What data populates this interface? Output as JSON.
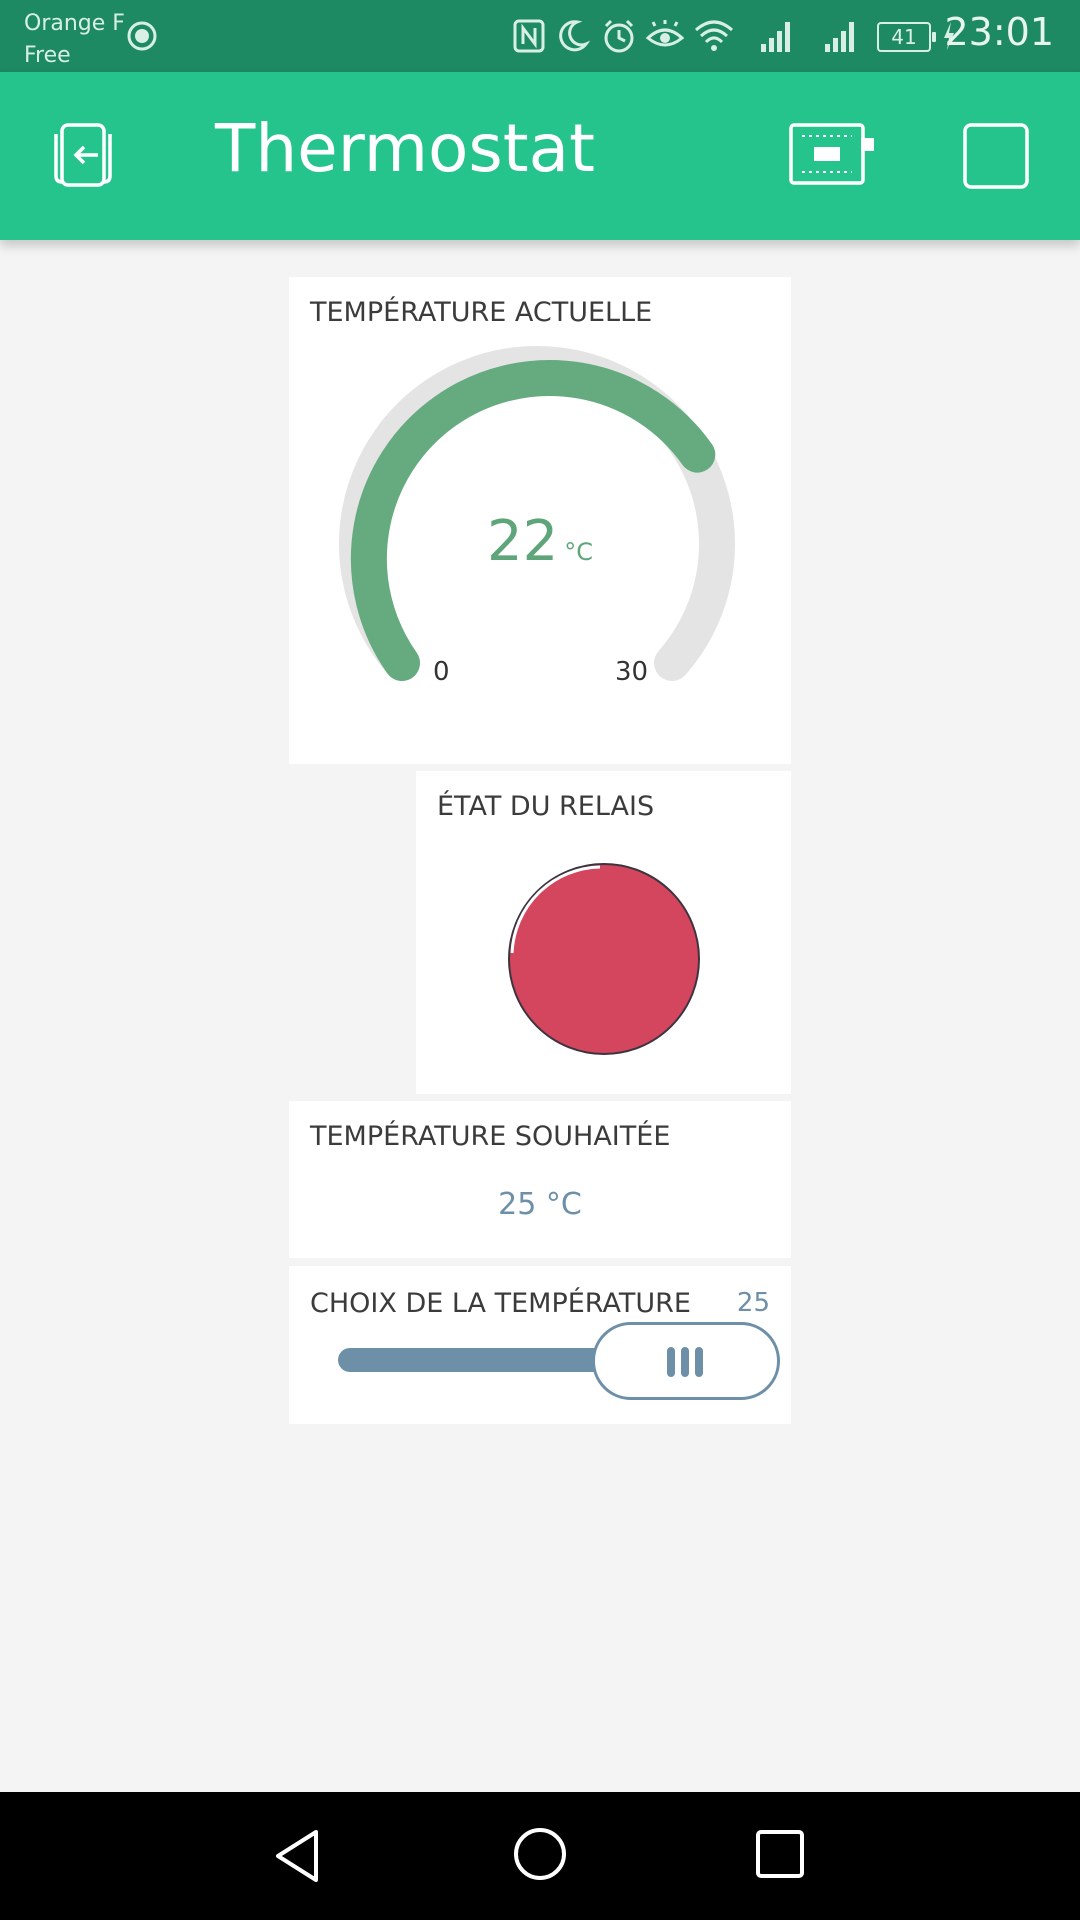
{
  "status_bar": {
    "carrier_line1": "Orange F",
    "carrier_line2": "Free",
    "battery": "41",
    "time": "23:01",
    "icons": [
      "hotspot-icon",
      "nfc-icon",
      "moon-icon",
      "alarm-icon",
      "eye-icon",
      "wifi-icon",
      "signal-icon",
      "signal-icon",
      "battery-icon",
      "charging-icon"
    ]
  },
  "app_bar": {
    "title": "Thermostat",
    "icons": [
      "exit-icon",
      "device-icon",
      "stop-icon"
    ]
  },
  "widgets": {
    "gauge": {
      "label": "TEMPÉRATURE ACTUELLE",
      "value": "22",
      "unit": "°C",
      "min": "0",
      "max": "30",
      "color": "#66ab80"
    },
    "led": {
      "label": "ÉTAT DU RELAIS",
      "color": "#d4455e"
    },
    "desired": {
      "label": "TEMPÉRATURE SOUHAITÉE",
      "value": "25 °C"
    },
    "slider": {
      "label": "CHOIX DE LA TEMPÉRATURE",
      "value": "25",
      "color": "#6e8fa8"
    }
  },
  "nav_bar": {
    "icons": [
      "back-icon",
      "home-icon",
      "recents-icon"
    ]
  }
}
